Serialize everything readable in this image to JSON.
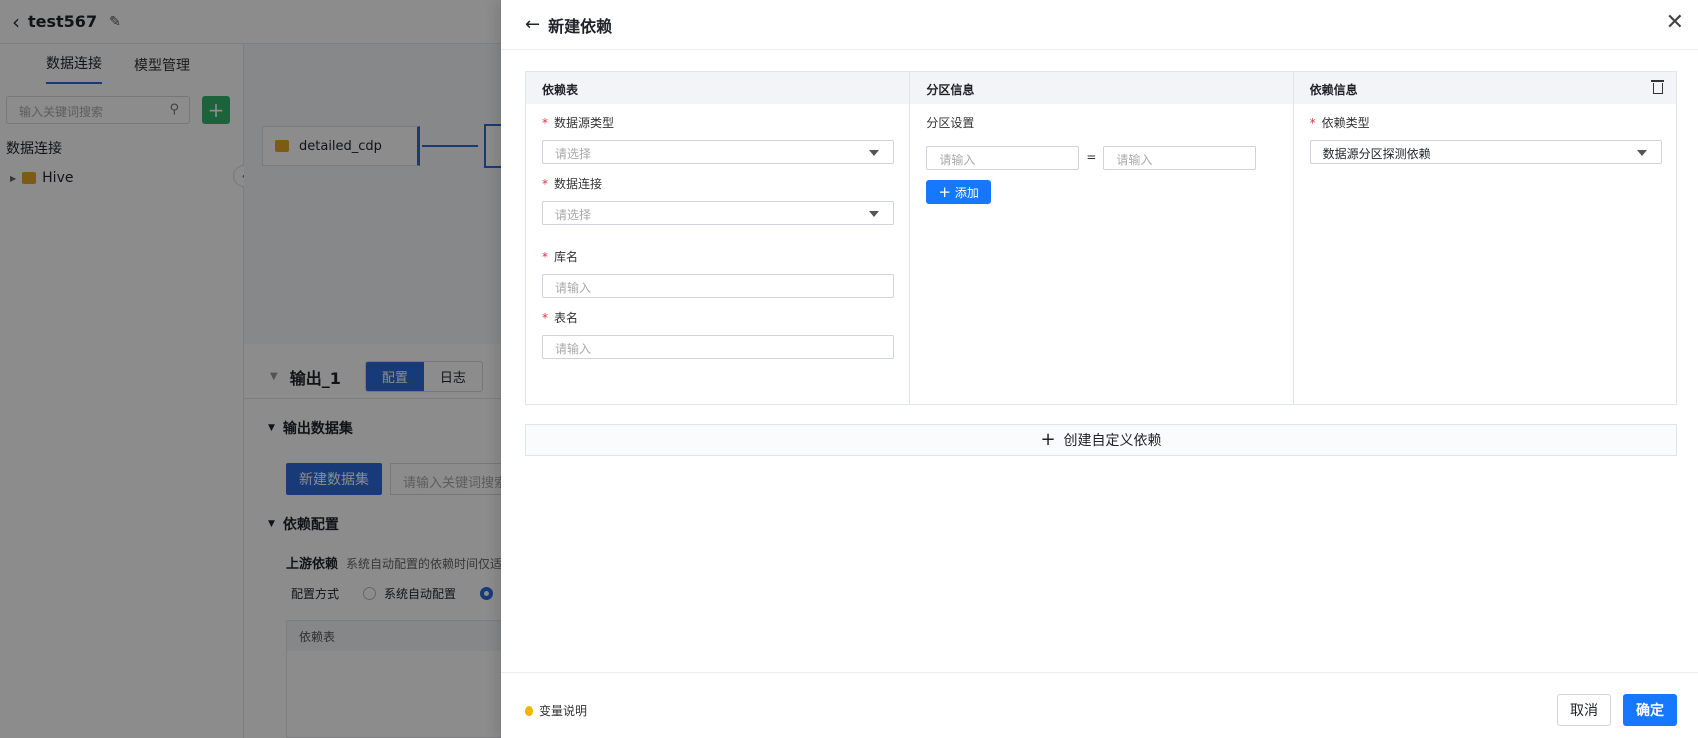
{
  "app": {
    "project_title": "test567",
    "tabs": [
      "数据连接",
      "模型管理"
    ],
    "search_placeholder": "输入关键词搜索",
    "section_title": "数据连接",
    "tree_item": "Hive",
    "node_label": "detailed_cdp",
    "output_title": "输出_1",
    "output_tabs": [
      "配置",
      "日志"
    ],
    "output_dataset_title": "输出数据集",
    "new_dataset_button": "新建数据集",
    "dataset_search_placeholder": "请输入关键词搜索",
    "dep_config_title": "依赖配置",
    "upstream_label": "上游依赖",
    "upstream_desc": "系统自动配置的依赖时间仅适",
    "config_mode_label": "配置方式",
    "config_mode_auto": "系统自动配置",
    "dep_table_header": "依赖表"
  },
  "drawer": {
    "title": "新建依赖",
    "columns": {
      "dep_table": "依赖表",
      "partition": "分区信息",
      "dep_info": "依赖信息"
    },
    "fields": {
      "source_type": {
        "label": "数据源类型",
        "placeholder": "请选择"
      },
      "connection": {
        "label": "数据连接",
        "placeholder": "请选择"
      },
      "db_name": {
        "label": "库名",
        "placeholder": "请输入"
      },
      "table_name": {
        "label": "表名",
        "placeholder": "请输入"
      }
    },
    "partition": {
      "label": "分区设置",
      "key_placeholder": "请输入",
      "equals": "=",
      "value_placeholder": "请输入",
      "add_button": "添加"
    },
    "dep_info": {
      "type_label": "依赖类型",
      "type_value": "数据源分区探测依赖"
    },
    "create_custom": "创建自定义依赖",
    "footer": {
      "var_note": "变量说明",
      "cancel": "取消",
      "confirm": "确定"
    }
  },
  "colors": {
    "primary": "#1677ff",
    "required": "#e0334a",
    "mask": "rgba(0,0,0,0.45)"
  }
}
